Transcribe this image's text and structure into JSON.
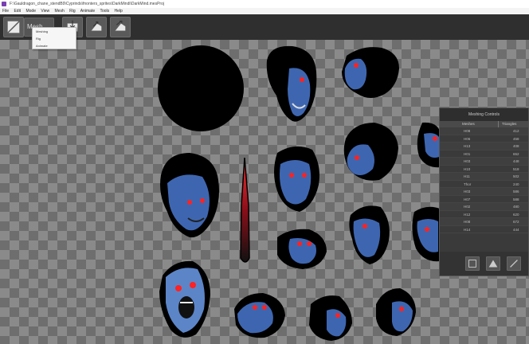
{
  "window": {
    "title": "F:\\Gauldragon_chane_stendB9\\Cyprinds\\fnonters_sprites\\DarkMindi\\DarkMind.mesProj"
  },
  "menubar": {
    "items": [
      "File",
      "Edit",
      "Mode",
      "View",
      "Mesh",
      "Rig",
      "Animate",
      "Tools",
      "Help"
    ]
  },
  "toolbar": {
    "mode_label": "Mesh",
    "mode_options": [
      "Meshing",
      "Rig",
      "Animate"
    ],
    "tools": [
      "grid-tool-icon",
      "import-icon",
      "export-icon"
    ]
  },
  "meshing_panel": {
    "title": "Meshing Controls",
    "columns": [
      "Meshes",
      "Triangles"
    ],
    "rows": [
      {
        "mesh": "H08",
        "triangles": "412"
      },
      {
        "mesh": "H06",
        "triangles": "458"
      },
      {
        "mesh": "H13",
        "triangles": "408"
      },
      {
        "mesh": "H01",
        "triangles": "652"
      },
      {
        "mesh": "H03",
        "triangles": "448"
      },
      {
        "mesh": "H10",
        "triangles": "518"
      },
      {
        "mesh": "H11",
        "triangles": "502"
      },
      {
        "mesh": "Thor",
        "triangles": "240"
      },
      {
        "mesh": "H03",
        "triangles": "586"
      },
      {
        "mesh": "H07",
        "triangles": "588"
      },
      {
        "mesh": "H02",
        "triangles": "480"
      },
      {
        "mesh": "H12",
        "triangles": "620"
      },
      {
        "mesh": "H08",
        "triangles": "672"
      },
      {
        "mesh": "H14",
        "triangles": "444"
      }
    ],
    "buttons": [
      "frame-icon",
      "mountain-icon",
      "brush-icon"
    ]
  },
  "colors": {
    "toolbar_bg": "#2f2f2f",
    "checker_light": "#8a8a8a",
    "checker_dark": "#6e6e6e",
    "sprite_blue": "#3e66b0",
    "eye_red": "#ff2222"
  }
}
